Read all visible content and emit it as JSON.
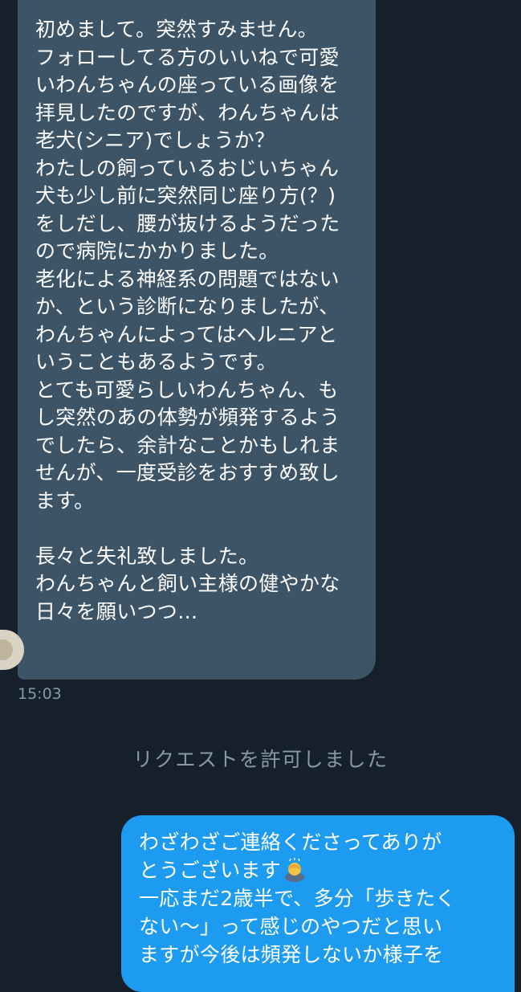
{
  "conversation": {
    "incoming_message": {
      "text": "初めまして。突然すみません。\nフォローしてる方のいいねで可愛\nいわんちゃんの座っている画像を\n拝見したのですが、わんちゃんは\n老犬(シニア)でしょうか？\nわたしの飼っているおじいちゃん\n犬も少し前に突然同じ座り方(？)\nをしだし、腰が抜けるようだった\nので病院にかかりました。\n老化による神経系の問題ではない\nか、という診断になりましたが、\nわんちゃんによってはヘルニアと\nいうこともあるようです。\nとても可愛らしいわんちゃん、も\nし突然のあの体勢が頻発するよう\nでしたら、余計なことかもしれま\nせんが、一度受診をおすすめ致し\nます。\n\n長々と失礼致しました。\nわんちゃんと飼い主様の健やかな\n日々を願いつつ…",
      "timestamp": "15:03"
    },
    "system_notice": "リクエストを許可しました",
    "outgoing_message": {
      "text_before_emoji": "わざわざご連絡くださってありが\nとうございます",
      "emoji": "person-bowing-emoji",
      "text_after_emoji": "\n一応まだ2歳半で、多分「歩きたく\nない〜」って感じのやつだと思い\nますが今後は頻発しないか様子を"
    }
  },
  "colors": {
    "background": "#15202b",
    "incoming_bubble": "#3d5466",
    "outgoing_bubble": "#1d9bf0",
    "muted_text": "#8899a6"
  }
}
